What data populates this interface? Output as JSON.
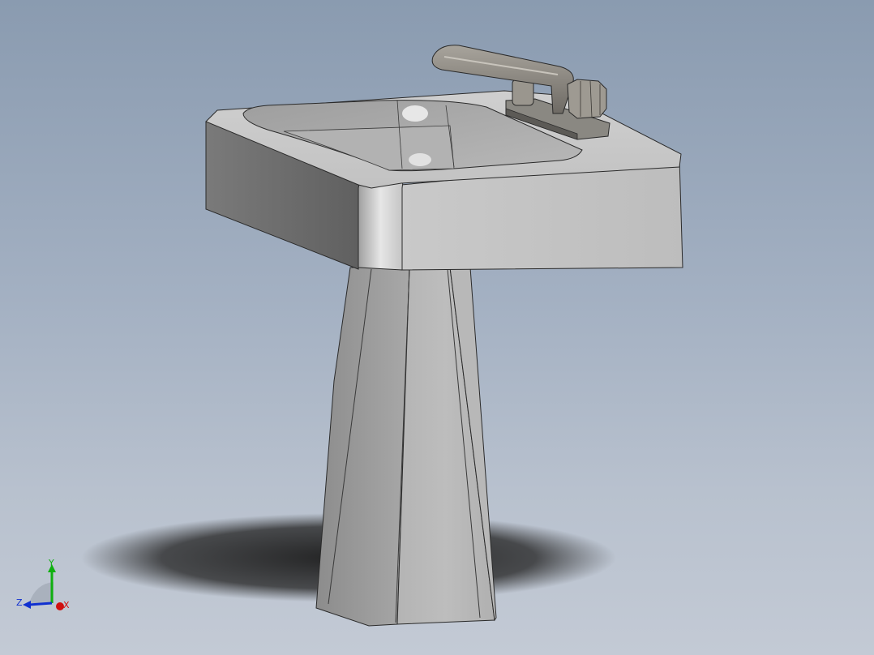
{
  "viewport": {
    "model_name": "pedestal-sink",
    "background_top": "#8a9bb0",
    "background_bottom": "#c3cad5"
  },
  "triad": {
    "x_label": "X",
    "y_label": "Y",
    "z_label": "Z",
    "x_color": "#d01010",
    "y_color": "#10b010",
    "z_color": "#1030d0"
  }
}
